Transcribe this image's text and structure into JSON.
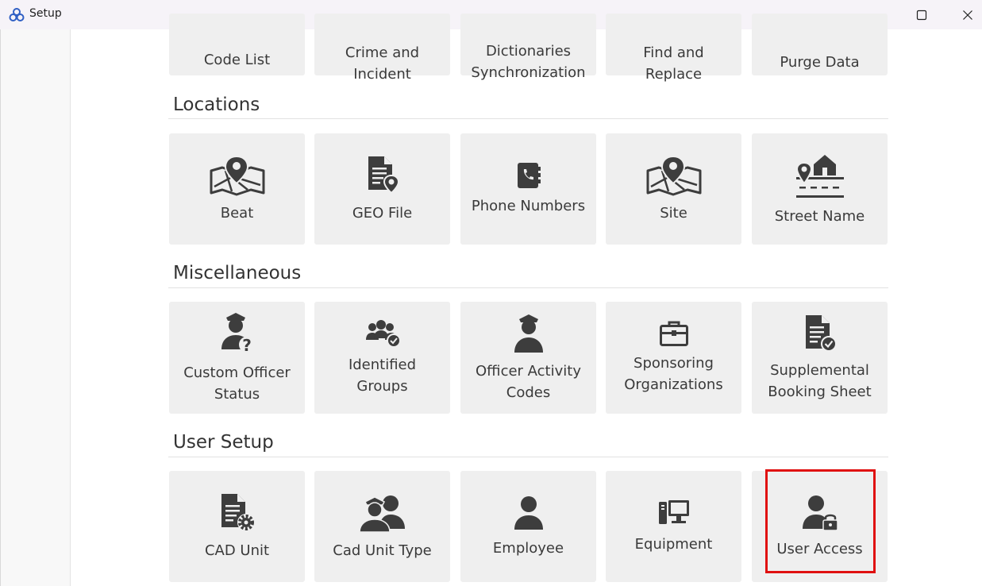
{
  "window": {
    "title": "Setup",
    "minimize_icon": "minimize-icon",
    "maximize_icon": "maximize-icon",
    "close_icon": "close-icon"
  },
  "top_row": [
    {
      "label": "Code List"
    },
    {
      "label": "Crime and Incident"
    },
    {
      "label": "Dictionaries Synchronization"
    },
    {
      "label": "Find and Replace"
    },
    {
      "label": "Purge Data"
    }
  ],
  "sections": {
    "locations": {
      "title": "Locations",
      "tiles": [
        {
          "label": "Beat",
          "icon": "map-pin-icon"
        },
        {
          "label": "GEO File",
          "icon": "document-location-icon"
        },
        {
          "label": "Phone Numbers",
          "icon": "phone-book-icon"
        },
        {
          "label": "Site",
          "icon": "map-pin-icon"
        },
        {
          "label": "Street Name",
          "icon": "street-location-icon"
        }
      ]
    },
    "miscellaneous": {
      "title": "Miscellaneous",
      "tiles": [
        {
          "label": "Custom Officer Status",
          "icon": "officer-question-icon"
        },
        {
          "label": "Identified Groups",
          "icon": "group-check-icon"
        },
        {
          "label": "Officer Activity Codes",
          "icon": "officer-icon"
        },
        {
          "label": "Sponsoring Organizations",
          "icon": "briefcase-icon"
        },
        {
          "label": "Supplemental Booking Sheet",
          "icon": "document-check-icon"
        }
      ]
    },
    "user_setup": {
      "title": "User Setup",
      "tiles": [
        {
          "label": "CAD Unit",
          "icon": "document-gear-icon"
        },
        {
          "label": "Cad Unit Type",
          "icon": "officer-users-icon"
        },
        {
          "label": "Employee",
          "icon": "user-icon"
        },
        {
          "label": "Equipment",
          "icon": "computer-icon"
        },
        {
          "label": "User Access",
          "icon": "user-lock-icon"
        }
      ]
    }
  },
  "colors": {
    "tile_bg": "#efefef",
    "icon": "#3d3d3d",
    "highlight": "#e01010",
    "titlebar_bg": "#f6f3f8"
  }
}
